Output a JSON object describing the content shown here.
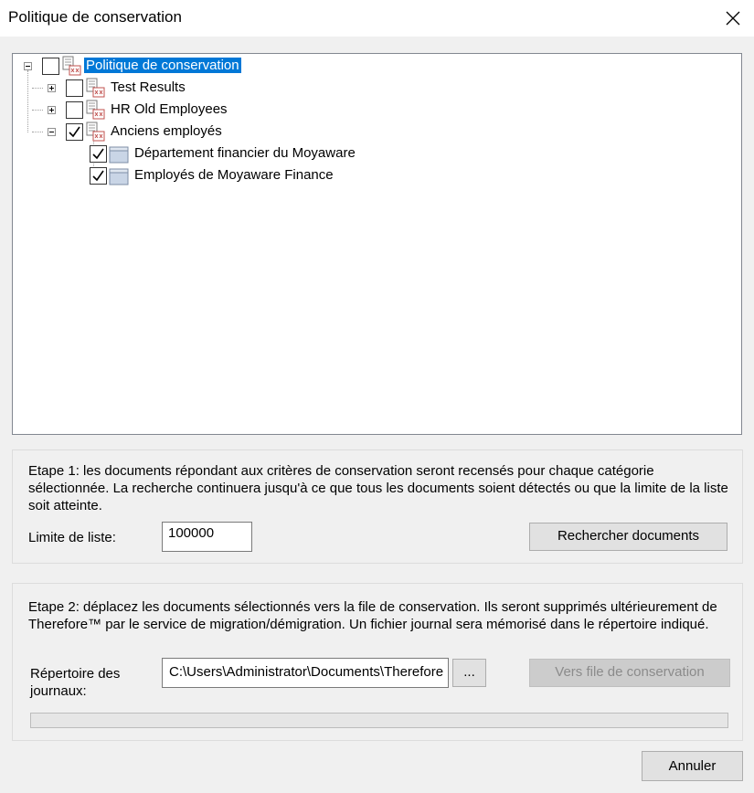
{
  "window": {
    "title": "Politique de conservation",
    "close_icon": "close-icon"
  },
  "tree": {
    "root": {
      "label": "Politique de conservation",
      "checked": false,
      "expanded": true,
      "selected": true
    },
    "children": [
      {
        "label": "Test Results",
        "checked": false,
        "expanded": false
      },
      {
        "label": "HR Old Employees",
        "checked": false,
        "expanded": false
      },
      {
        "label": "Anciens employés",
        "checked": true,
        "expanded": true,
        "children": [
          {
            "label": "Département financier du Moyaware",
            "checked": true
          },
          {
            "label": "Employés de Moyaware Finance",
            "checked": true
          }
        ]
      }
    ]
  },
  "step1": {
    "text": "Etape 1: les documents répondant aux critères de conservation seront recensés pour chaque catégorie sélectionnée. La recherche continuera jusqu'à ce que tous les documents soient détectés ou que la limite de la liste soit atteinte.",
    "limit_label": "Limite de liste:",
    "limit_value": "100000",
    "search_button": "Rechercher documents"
  },
  "step2": {
    "text": "Etape 2: déplacez les documents sélectionnés vers la file de conservation. Ils seront supprimés ultérieurement de Therefore™ par le service de migration/démigration. Un fichier journal sera mémorisé dans le répertoire indiqué.",
    "log_dir_label": "Répertoire des journaux:",
    "log_dir_value": "C:\\Users\\Administrator\\Documents\\Therefore",
    "browse_button": "...",
    "move_button": "Vers file de conservation",
    "move_button_enabled": false,
    "progress": 0
  },
  "footer": {
    "cancel_button": "Annuler"
  },
  "colors": {
    "selection": "#0078d7",
    "background": "#f0f0f0"
  }
}
